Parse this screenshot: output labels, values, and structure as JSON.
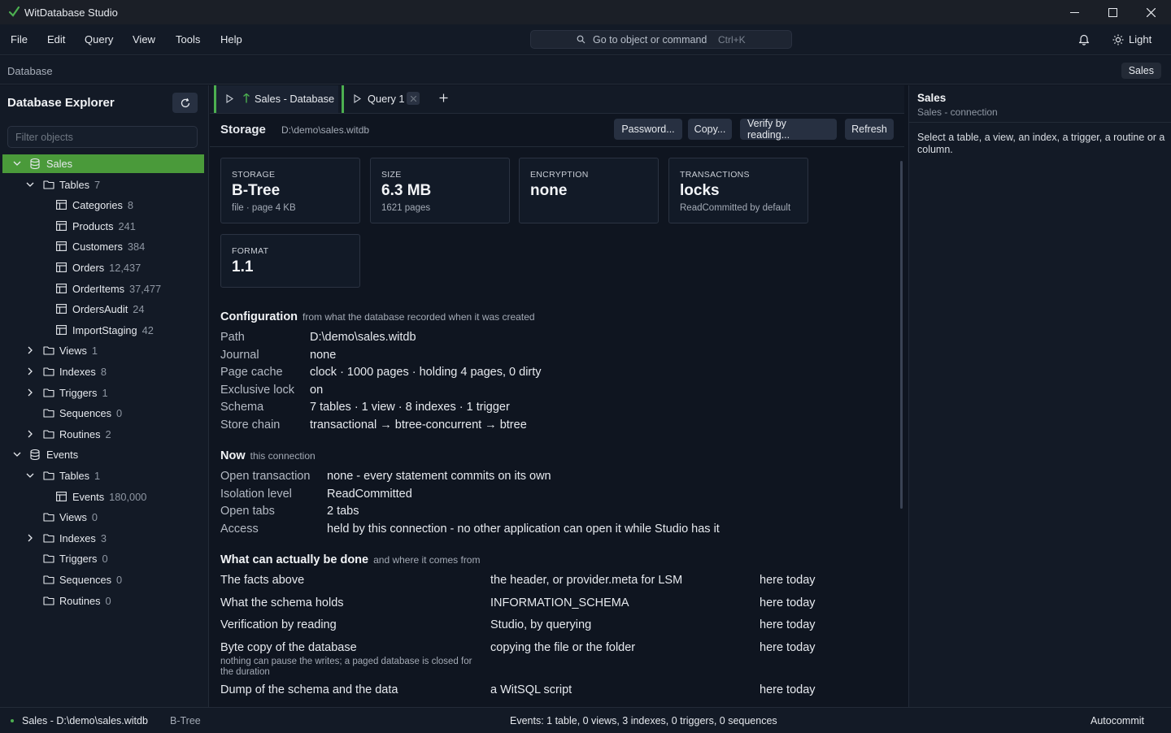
{
  "app": {
    "title": "WitDatabase Studio"
  },
  "menu": [
    "File",
    "Edit",
    "Query",
    "View",
    "Tools",
    "Help"
  ],
  "command": {
    "placeholder": "Go to object or command",
    "shortcut": "Ctrl+K"
  },
  "theme_toggle": "Light",
  "context": {
    "label": "Database",
    "chip": "Sales"
  },
  "explorer": {
    "title": "Database Explorer",
    "filter_placeholder": "Filter objects",
    "tree": [
      {
        "label": "Sales",
        "count": "",
        "level": 0,
        "icon": "database-icon",
        "chevron": "down",
        "selected": true
      },
      {
        "label": "Tables",
        "count": "7",
        "level": 1,
        "icon": "folder-icon",
        "chevron": "down"
      },
      {
        "label": "Categories",
        "count": "8",
        "level": 2,
        "icon": "table-icon",
        "chevron": ""
      },
      {
        "label": "Products",
        "count": "241",
        "level": 2,
        "icon": "table-icon",
        "chevron": ""
      },
      {
        "label": "Customers",
        "count": "384",
        "level": 2,
        "icon": "table-icon",
        "chevron": ""
      },
      {
        "label": "Orders",
        "count": "12,437",
        "level": 2,
        "icon": "table-icon",
        "chevron": ""
      },
      {
        "label": "OrderItems",
        "count": "37,477",
        "level": 2,
        "icon": "table-icon",
        "chevron": ""
      },
      {
        "label": "OrdersAudit",
        "count": "24",
        "level": 2,
        "icon": "table-icon",
        "chevron": ""
      },
      {
        "label": "ImportStaging",
        "count": "42",
        "level": 2,
        "icon": "table-icon",
        "chevron": ""
      },
      {
        "label": "Views",
        "count": "1",
        "level": 1,
        "icon": "folder-icon",
        "chevron": "right"
      },
      {
        "label": "Indexes",
        "count": "8",
        "level": 1,
        "icon": "folder-icon",
        "chevron": "right"
      },
      {
        "label": "Triggers",
        "count": "1",
        "level": 1,
        "icon": "folder-icon",
        "chevron": "right"
      },
      {
        "label": "Sequences",
        "count": "0",
        "level": 1,
        "icon": "folder-icon",
        "chevron": ""
      },
      {
        "label": "Routines",
        "count": "2",
        "level": 1,
        "icon": "folder-icon",
        "chevron": "right"
      },
      {
        "label": "Events",
        "count": "",
        "level": 0,
        "icon": "database-icon",
        "chevron": "down"
      },
      {
        "label": "Tables",
        "count": "1",
        "level": 1,
        "icon": "folder-icon",
        "chevron": "down"
      },
      {
        "label": "Events",
        "count": "180,000",
        "level": 2,
        "icon": "table-icon",
        "chevron": ""
      },
      {
        "label": "Views",
        "count": "0",
        "level": 1,
        "icon": "folder-icon",
        "chevron": ""
      },
      {
        "label": "Indexes",
        "count": "3",
        "level": 1,
        "icon": "folder-icon",
        "chevron": "right"
      },
      {
        "label": "Triggers",
        "count": "0",
        "level": 1,
        "icon": "folder-icon",
        "chevron": ""
      },
      {
        "label": "Sequences",
        "count": "0",
        "level": 1,
        "icon": "folder-icon",
        "chevron": ""
      },
      {
        "label": "Routines",
        "count": "0",
        "level": 1,
        "icon": "folder-icon",
        "chevron": ""
      }
    ]
  },
  "tabs": [
    {
      "label": "Sales - Database",
      "active": true
    },
    {
      "label": "Query 1",
      "active": false
    }
  ],
  "storage": {
    "title": "Storage",
    "path": "D:\\demo\\sales.witdb",
    "buttons": [
      "Password...",
      "Copy...",
      "Verify by reading...",
      "Refresh"
    ],
    "cards": [
      {
        "key": "STORAGE",
        "value": "B-Tree",
        "sub": "file · page 4 KB"
      },
      {
        "key": "SIZE",
        "value": "6.3 MB",
        "sub": "1621 pages"
      },
      {
        "key": "ENCRYPTION",
        "value": "none",
        "sub": ""
      },
      {
        "key": "TRANSACTIONS",
        "value": "locks",
        "sub": "ReadCommitted by default"
      },
      {
        "key": "FORMAT",
        "value": "1.1",
        "sub": ""
      }
    ]
  },
  "configuration": {
    "title": "Configuration",
    "subtitle": "from what the database recorded when it was created",
    "rows": [
      {
        "k": "Path",
        "v": "D:\\demo\\sales.witdb"
      },
      {
        "k": "Journal",
        "v": "none"
      },
      {
        "k": "Page cache",
        "v": "clock · 1000 pages · holding 4 pages, 0 dirty"
      },
      {
        "k": "Exclusive lock",
        "v": "on"
      },
      {
        "k": "Schema",
        "v": "7 tables · 1 view · 8 indexes · 1 trigger"
      },
      {
        "k": "Store chain",
        "v": "transactional → btree-concurrent → btree"
      }
    ]
  },
  "now": {
    "title": "Now",
    "subtitle": "this connection",
    "rows": [
      {
        "k": "Open transaction",
        "v": "none - every statement commits on its own"
      },
      {
        "k": "Isolation level",
        "v": "ReadCommitted"
      },
      {
        "k": "Open tabs",
        "v": "2 tabs"
      },
      {
        "k": "Access",
        "v": "held by this connection - no other application can open it while Studio has it"
      }
    ]
  },
  "capabilities": {
    "title": "What can actually be done",
    "subtitle": "and where it comes from",
    "rows": [
      {
        "what": "The facts above",
        "source": "the header, or provider.meta for LSM",
        "when": "here today",
        "note": ""
      },
      {
        "what": "What the schema holds",
        "source": "INFORMATION_SCHEMA",
        "when": "here today",
        "note": ""
      },
      {
        "what": "Verification by reading",
        "source": "Studio, by querying",
        "when": "here today",
        "note": ""
      },
      {
        "what": "Byte copy of the database",
        "source": "copying the file or the folder",
        "when": "here today",
        "note": "nothing can pause the writes; a paged database is closed for the duration"
      },
      {
        "what": "Dump of the schema and the data",
        "source": "a WitSQL script",
        "when": "here today",
        "note": ""
      }
    ]
  },
  "inspector": {
    "title": "Sales",
    "subtitle": "Sales - connection",
    "hint": "Select a table, a view, an index, a trigger, a routine or a column."
  },
  "status": {
    "connection": "Sales - D:\\demo\\sales.witdb",
    "engine": "B-Tree",
    "summary": "Events: 1 table, 0 views, 3 indexes, 0 triggers, 0 sequences",
    "mode": "Autocommit"
  },
  "colors": {
    "accent": "#4caf50",
    "selected_row": "#4a9a3a",
    "background": "#0f1520",
    "panel": "#131a26"
  }
}
